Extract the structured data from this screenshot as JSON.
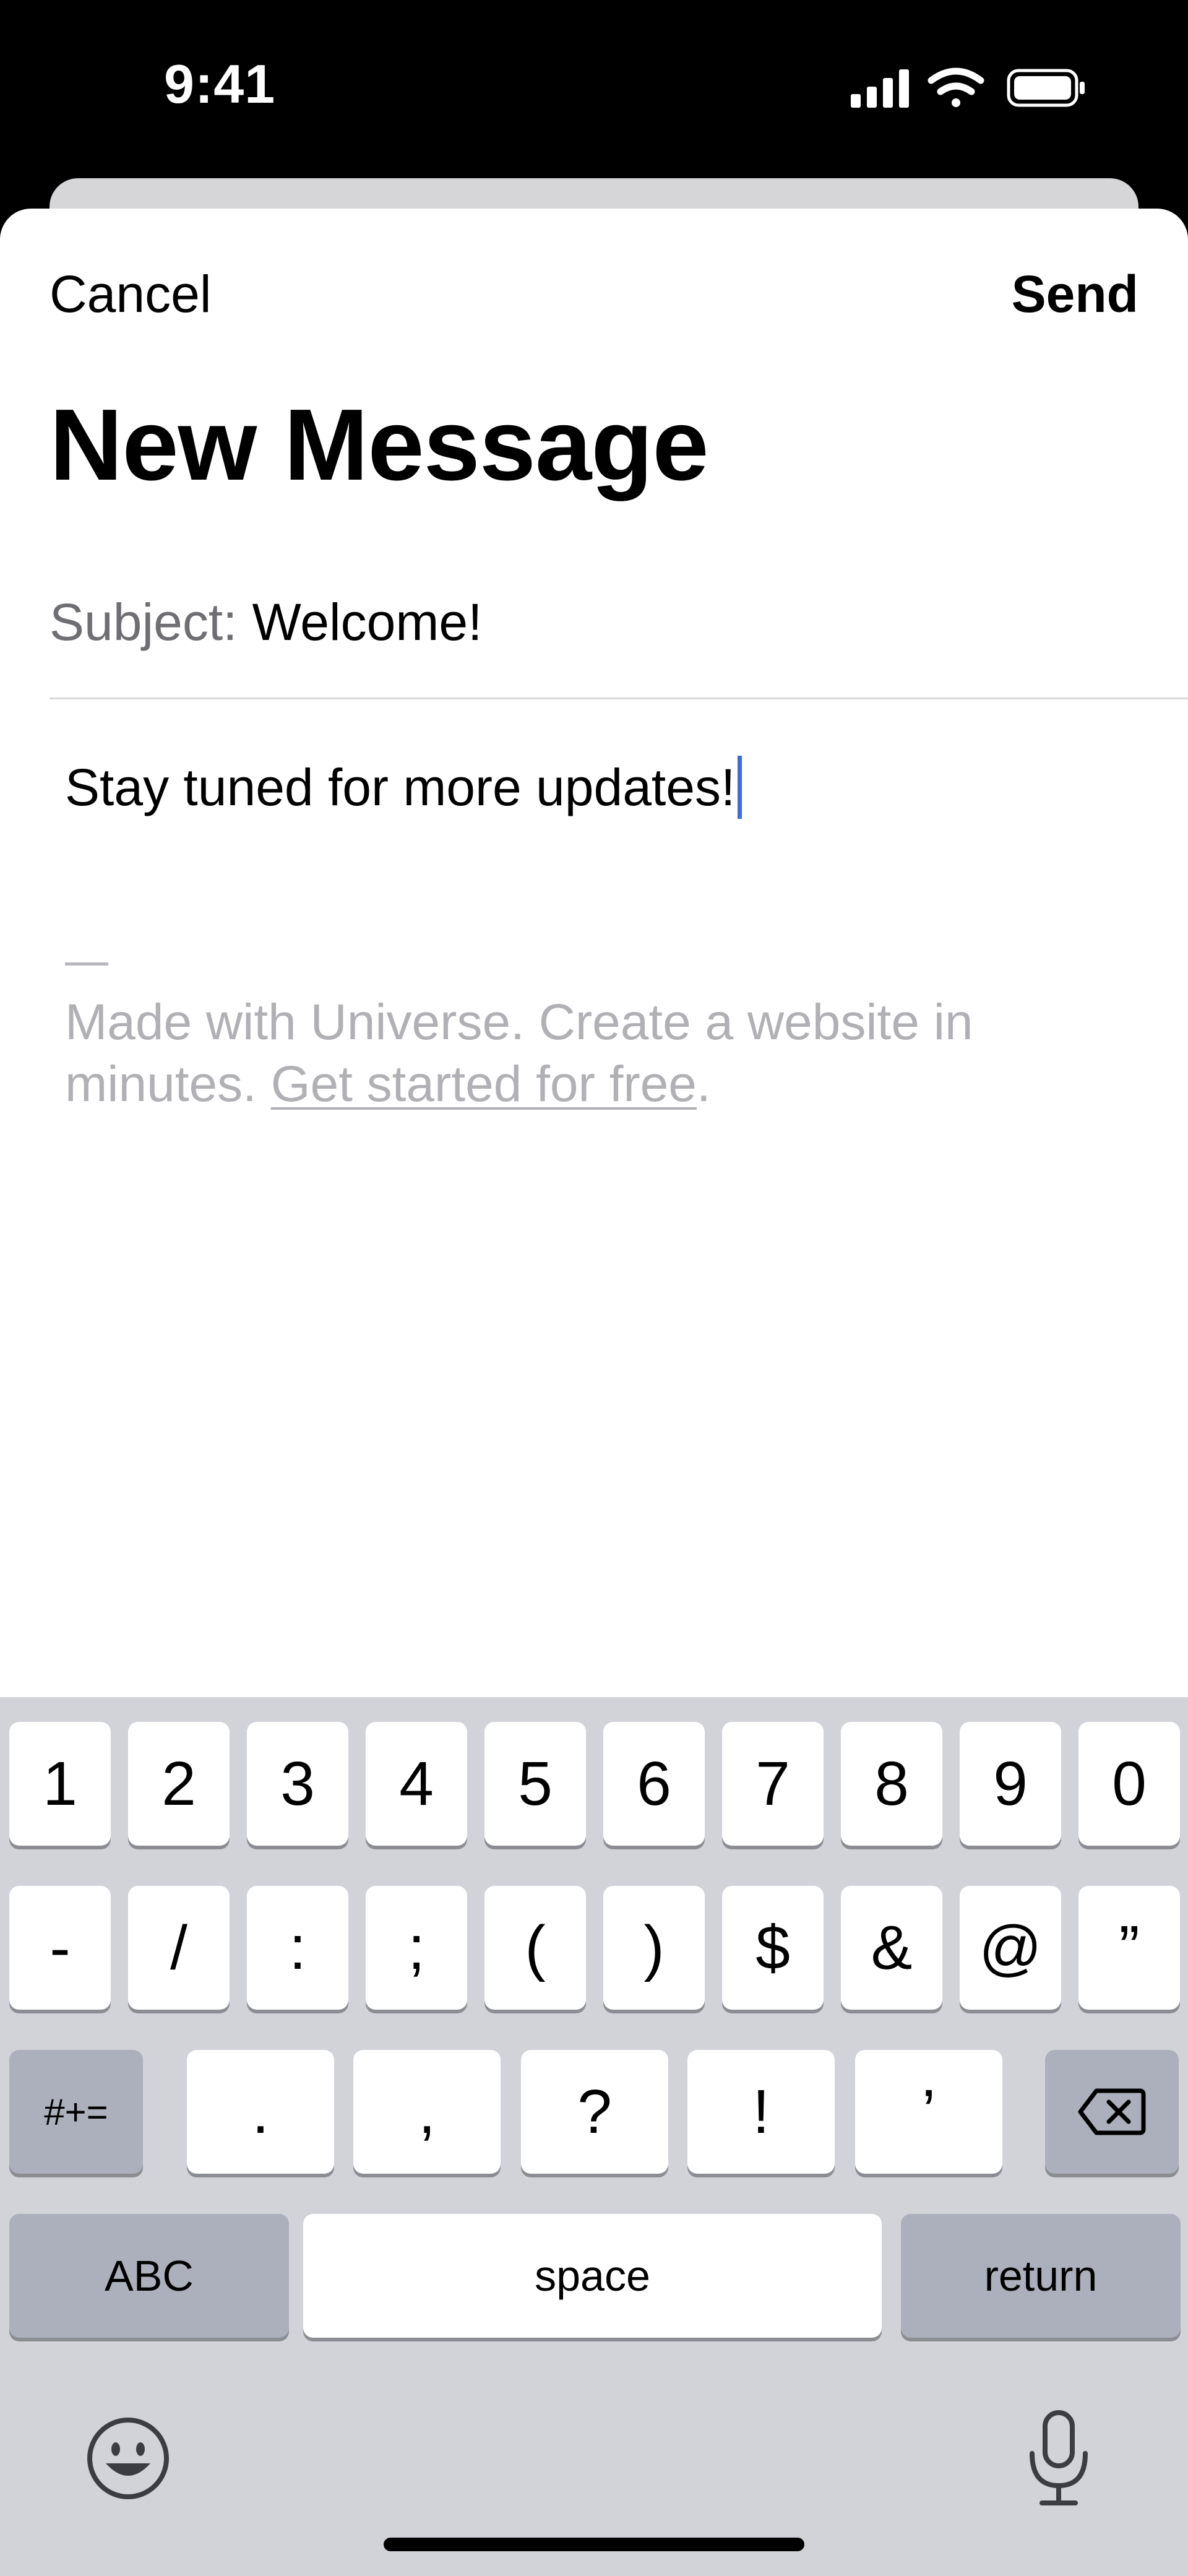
{
  "status_bar": {
    "time": "9:41",
    "icons": [
      "cellular-signal-icon",
      "wifi-icon",
      "battery-icon"
    ]
  },
  "nav": {
    "cancel_label": "Cancel",
    "send_label": "Send"
  },
  "title": "New Message",
  "subject": {
    "label": "Subject:",
    "value": "Welcome!"
  },
  "body": {
    "text": "Stay tuned for more updates!",
    "signature_dash": "—",
    "signature_text": "Made with Universe. Create a website in minutes.",
    "signature_link": "Get started for free",
    "signature_end": "."
  },
  "keyboard": {
    "row1": [
      "1",
      "2",
      "3",
      "4",
      "5",
      "6",
      "7",
      "8",
      "9",
      "0"
    ],
    "row2": [
      "-",
      "/",
      ":",
      ";",
      "(",
      ")",
      "$",
      "&",
      "@",
      "”"
    ],
    "row3": {
      "symbols_toggle": "#+=",
      "keys": [
        ".",
        ",",
        "?",
        "!",
        "’"
      ],
      "delete_icon": "delete-backspace-icon"
    },
    "row4": {
      "abc": "ABC",
      "space": "space",
      "return": "return"
    },
    "bottom": {
      "emoji_icon": "emoji-icon",
      "mic_icon": "microphone-icon"
    }
  },
  "colors": {
    "caret": "#3f6bd8",
    "keyboard_bg": "#d1d3d9",
    "key_dark": "#abb0bc",
    "signature": "#b0b0b5"
  }
}
